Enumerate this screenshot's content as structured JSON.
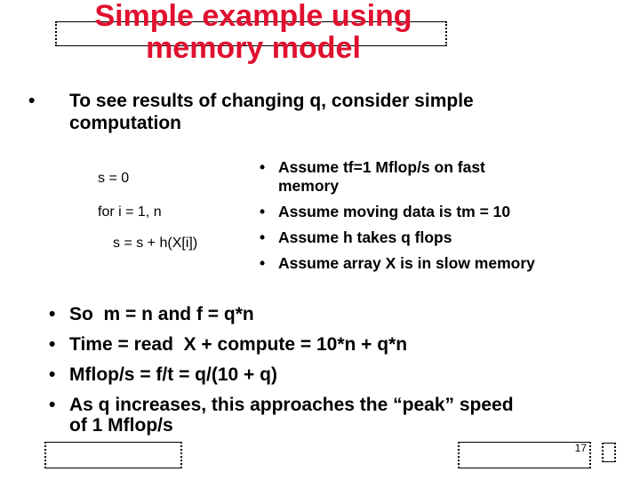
{
  "slide": {
    "title": "Simple example using memory model",
    "title_lines": [
      "Simple example using",
      "memory model"
    ],
    "title_color": "#e0102f",
    "intro_bullet": {
      "bullet": "•",
      "lines": [
        "To see results of changing q, consider simple",
        "computation"
      ]
    },
    "code": {
      "lines": [
        "s = 0",
        "for i = 1, n",
        "s = s + h(X[i])"
      ]
    },
    "assumptions": [
      {
        "bullet": "•",
        "lines": [
          "Assume tf=1 Mflop/s on fast",
          "memory"
        ]
      },
      {
        "bullet": "•",
        "lines": [
          "Assume moving data is tm = 10"
        ]
      },
      {
        "bullet": "•",
        "lines": [
          "Assume h takes q flops"
        ]
      },
      {
        "bullet": "•",
        "lines": [
          "Assume array X is in slow memory"
        ]
      }
    ],
    "conclusions": [
      {
        "bullet": "•",
        "lines": [
          "So  m = n and f = q*n"
        ]
      },
      {
        "bullet": "•",
        "lines": [
          "Time = read  X + compute = 10*n + q*n"
        ]
      },
      {
        "bullet": "•",
        "lines": [
          "Mflop/s = f/t = q/(10 + q)"
        ]
      },
      {
        "bullet": "•",
        "lines": [
          "As q increases, this approaches the “peak” speed",
          "of 1 Mflop/s"
        ]
      }
    ],
    "page_number": "17"
  }
}
